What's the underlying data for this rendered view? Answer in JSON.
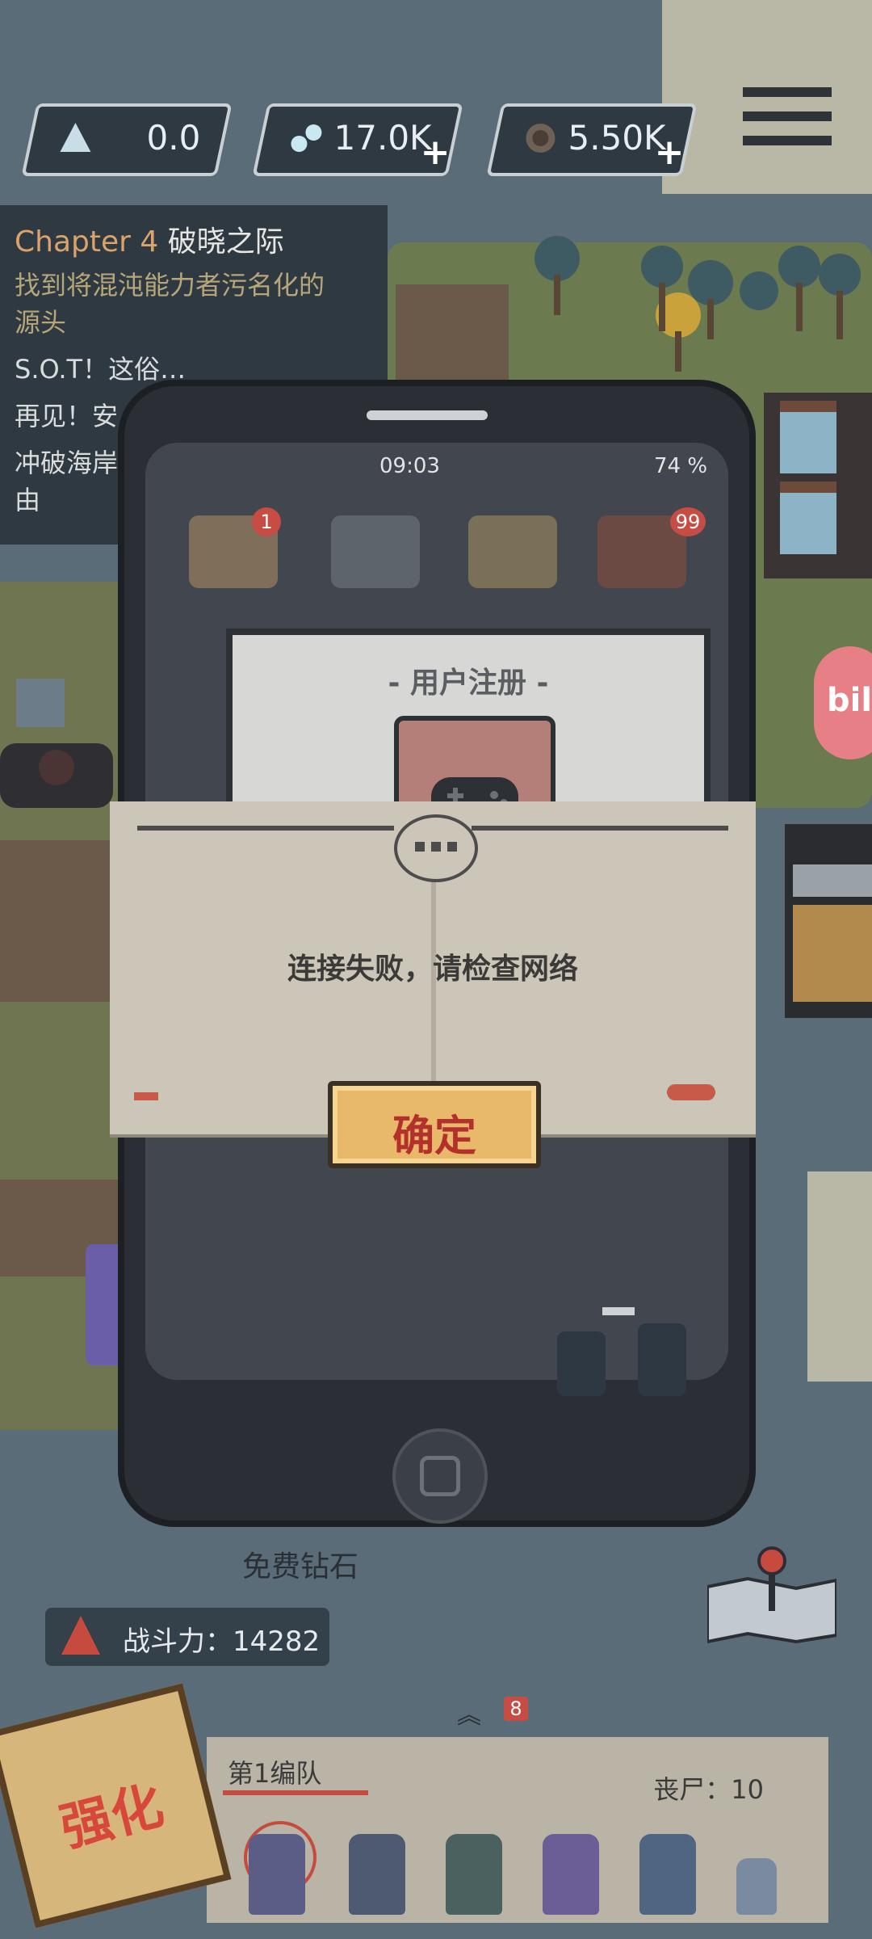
{
  "hud": {
    "resource1": "0.0",
    "resource2": "17.0K",
    "resource3": "5.50K",
    "plus": "+",
    "icons": [
      "triangle-icon",
      "bottle-icon",
      "coin-icon",
      "menu-icon"
    ]
  },
  "quest": {
    "chapter": "Chapter 4",
    "chapter_title": "破晓之际",
    "line1": "找到将混沌能力者污名化的",
    "line1b": "源头",
    "line2": "S.O.T！这俗…",
    "line3": "再见！安…",
    "line4": "冲破海岸…",
    "line4b": "由"
  },
  "phone": {
    "time": "09:03",
    "battery": "74 %",
    "badge1": "1",
    "badge2": "99",
    "reg_title": "- 用户注册 -"
  },
  "dialog": {
    "message": "连接失败，请检查网络",
    "ok_label": "确定"
  },
  "bottom": {
    "free_diamond": "免费钻石",
    "power_label": "战斗力：14282",
    "team_title": "第1编队",
    "zombie_count": "丧尸：10",
    "strengthen": "强化",
    "bili": "bili",
    "team_badge": "8"
  },
  "colors": {
    "ok_text": "#b3302c",
    "ok_bg": "#e8b96a",
    "dialog_bg": "#ccc6b8",
    "phone_bg": "#2b2f35"
  }
}
